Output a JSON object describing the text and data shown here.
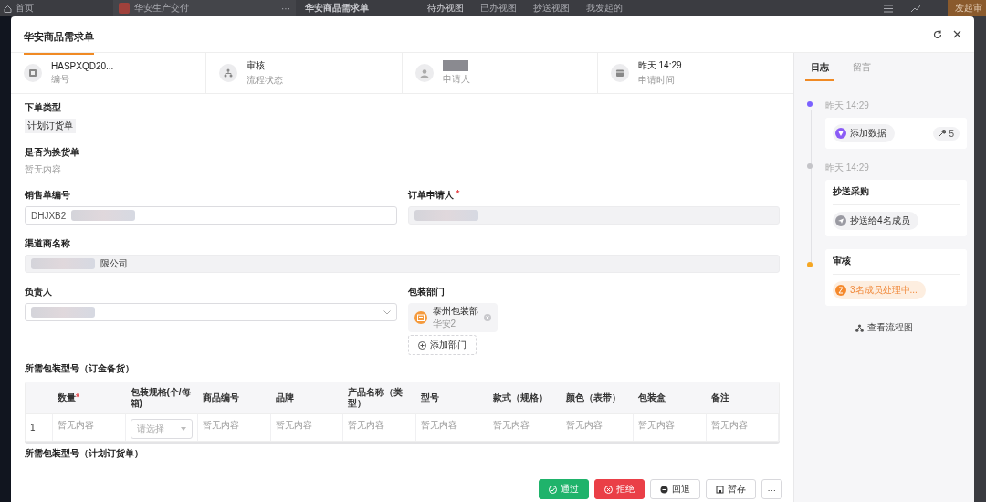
{
  "background_app": {
    "home": "首页",
    "app_name": "华安生产交付",
    "more": "···",
    "page_title": "华安商品需求单",
    "views": [
      {
        "label": "待办视图",
        "selected": true
      },
      {
        "label": "已办视图",
        "selected": false
      },
      {
        "label": "抄送视图",
        "selected": false
      },
      {
        "label": "我发起的",
        "selected": false
      }
    ],
    "start_button": "发起审"
  },
  "dialog": {
    "title": "华安商品需求单"
  },
  "summary": [
    {
      "kind": "number",
      "value": "HASPXQD20...",
      "label": "编号"
    },
    {
      "kind": "status",
      "value": "审核",
      "label": "流程状态"
    },
    {
      "kind": "person",
      "label": "申请人"
    },
    {
      "kind": "time",
      "value": "昨天 14:29",
      "label": "申请时间"
    }
  ],
  "form": {
    "rows": [
      [
        {
          "kind": "tag",
          "label": "下单类型",
          "value": "计划订货单"
        }
      ],
      [
        {
          "kind": "text",
          "label": "是否为换货单",
          "value": "暂无内容"
        }
      ],
      [
        {
          "kind": "input",
          "label": "销售单编号",
          "value": "DHJXB2"
        },
        {
          "kind": "readonly",
          "label": "订单申请人",
          "required_mark": "*"
        }
      ],
      [
        {
          "kind": "readonly",
          "label": "渠道商名称",
          "value": "限公司"
        }
      ],
      [
        {
          "kind": "select",
          "label": "负责人"
        },
        {
          "kind": "dept",
          "label": "包装部门",
          "chips": [
            {
              "name": "泰州包装部",
              "sub": "华安2"
            }
          ],
          "add": "添加部门"
        }
      ]
    ],
    "table_title": "所需包装型号（订金备货）",
    "table": {
      "columns": [
        {
          "label": "数量",
          "required_mark": "*"
        },
        {
          "label": "包装规格(个/每箱)"
        },
        {
          "label": "商品编号"
        },
        {
          "label": "品牌"
        },
        {
          "label": "产品名称（类型）"
        },
        {
          "label": "型号"
        },
        {
          "label": "款式（规格）"
        },
        {
          "label": "颜色（表带）"
        },
        {
          "label": "包装盒"
        },
        {
          "label": "备注"
        }
      ],
      "rows": [
        {
          "index": "1",
          "cells": [
            {
              "kind": "text",
              "value": "暂无内容"
            },
            {
              "kind": "select",
              "placeholder": "请选择"
            },
            {
              "kind": "text",
              "value": "暂无内容"
            },
            {
              "kind": "text",
              "value": "暂无内容"
            },
            {
              "kind": "text",
              "value": "暂无内容"
            },
            {
              "kind": "text",
              "value": "暂无内容"
            },
            {
              "kind": "text",
              "value": "暂无内容"
            },
            {
              "kind": "text",
              "value": "暂无内容"
            },
            {
              "kind": "text",
              "value": "暂无内容"
            },
            {
              "kind": "text",
              "value": "暂无内容"
            }
          ]
        }
      ]
    },
    "next_section_title": "所需包装型号（计划订货单）"
  },
  "actions": [
    {
      "kind": "approve",
      "label": "通过"
    },
    {
      "kind": "reject",
      "label": "拒绝"
    },
    {
      "kind": "return",
      "label": "回退"
    },
    {
      "kind": "save",
      "label": "暂存"
    },
    {
      "kind": "more",
      "label": "···"
    }
  ],
  "log": {
    "tabs": [
      {
        "label": "日志",
        "selected": true
      },
      {
        "label": "留言",
        "selected": false
      }
    ],
    "entries": [
      {
        "time": "昨天 14:29",
        "color": "#7b61ff",
        "chip": {
          "kind": "data",
          "label": "添加数据"
        },
        "badge": "5"
      },
      {
        "time": "昨天 14:29",
        "color": "#c4c4c8",
        "title": "抄送采购",
        "chip": {
          "kind": "cc",
          "label": "抄送给4名成员"
        }
      },
      {
        "color": "#f5a623",
        "title": "审核",
        "chip": {
          "kind": "pending",
          "label": "3名成员处理中..."
        }
      }
    ],
    "flow_link": "查看流程图"
  }
}
